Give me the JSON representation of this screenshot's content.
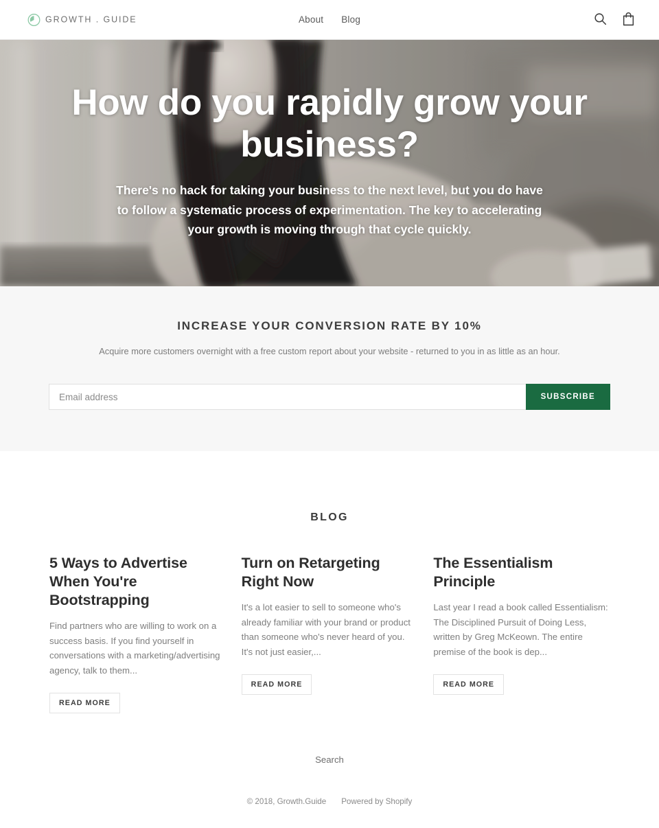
{
  "header": {
    "brand_name": "GROWTH . GUIDE",
    "brand_icon": "growth-circle-logo-icon",
    "nav": [
      {
        "label": "About"
      },
      {
        "label": "Blog"
      }
    ],
    "actions": [
      {
        "icon": "search-icon",
        "label": "Search"
      },
      {
        "icon": "shopping-bag-icon",
        "label": "Cart"
      }
    ]
  },
  "hero": {
    "title": "How do you rapidly grow your business?",
    "subtitle": "There's no hack for taking your business to the next level, but you do have to follow a systematic process of experimentation. The key to accelerating your growth is moving through that cycle quickly.",
    "image_description": "Grayscale photo of a smiling woman with long dark hair leaning on a table"
  },
  "newsletter": {
    "title": "INCREASE YOUR CONVERSION RATE BY 10%",
    "subtitle": "Acquire more customers overnight with a free custom report about your website - returned to you in as little as an hour.",
    "email_placeholder": "Email address",
    "email_value": "",
    "subscribe_label": "SUBSCRIBE",
    "accent_color": "#1a6b41",
    "background_color": "#f7f7f7"
  },
  "blog": {
    "heading": "BLOG",
    "posts": [
      {
        "title": "5 Ways to Advertise When You're Bootstrapping",
        "excerpt": "Find partners who are willing to work on a success basis. If you find yourself in conversations with a marketing/advertising agency, talk to them...",
        "read_more_label": "READ MORE"
      },
      {
        "title": "Turn on Retargeting Right Now",
        "excerpt": "It's a lot easier to sell to someone who's already familiar with your brand or product than someone who's never heard of you. It's not just easier,...",
        "read_more_label": "READ MORE"
      },
      {
        "title": "The Essentialism Principle",
        "excerpt": "Last year I read a book called Essentialism: The Disciplined Pursuit of Doing Less, written by Greg McKeown. The entire premise of the book is dep...",
        "read_more_label": "READ MORE"
      }
    ]
  },
  "footer": {
    "links": [
      {
        "label": "Search"
      }
    ],
    "copyright": "© 2018, Growth.Guide",
    "powered_by": "Powered by Shopify"
  }
}
